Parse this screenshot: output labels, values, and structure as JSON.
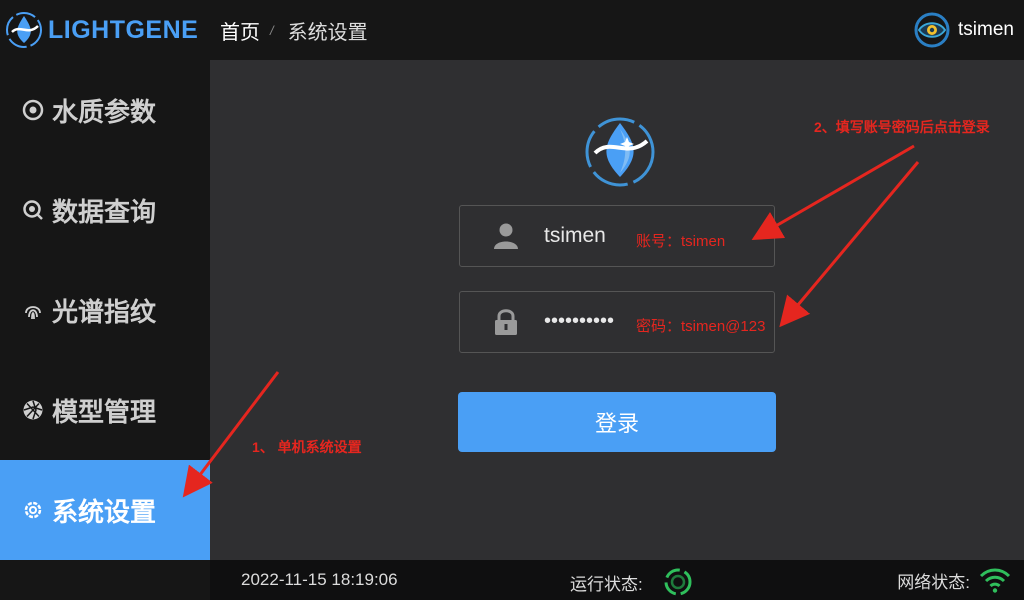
{
  "brand": {
    "name": "LIGHTGENE",
    "color": "#4a9ff5"
  },
  "sidebar": {
    "items": [
      {
        "label": "水质参数",
        "icon": "aperture-icon"
      },
      {
        "label": "数据查询",
        "icon": "magnifier-icon"
      },
      {
        "label": "光谱指纹",
        "icon": "fingerprint-icon"
      },
      {
        "label": "模型管理",
        "icon": "shutter-icon"
      },
      {
        "label": "系统设置",
        "icon": "gear-icon",
        "active": true
      }
    ]
  },
  "header": {
    "breadcrumb": {
      "home": "首页",
      "separator": "/",
      "current": "系统设置"
    },
    "user": {
      "name": "tsimen",
      "icon": "eye-logo-icon"
    }
  },
  "login": {
    "username_value": "tsimen",
    "username_hint": "账号：tsimen",
    "password_mask": "••••••••••",
    "password_hint": "密码：tsimen@123",
    "button_label": "登录"
  },
  "annotations": {
    "step1": "1、 单机系统设置",
    "step2": "2、填写账号密码后点击登录",
    "color": "#e5261f"
  },
  "footer": {
    "datetime": "2022-11-15 18:19:06",
    "run_status_label": "运行状态:",
    "network_status_label": "网络状态:",
    "status_color": "#2fbf5c"
  }
}
